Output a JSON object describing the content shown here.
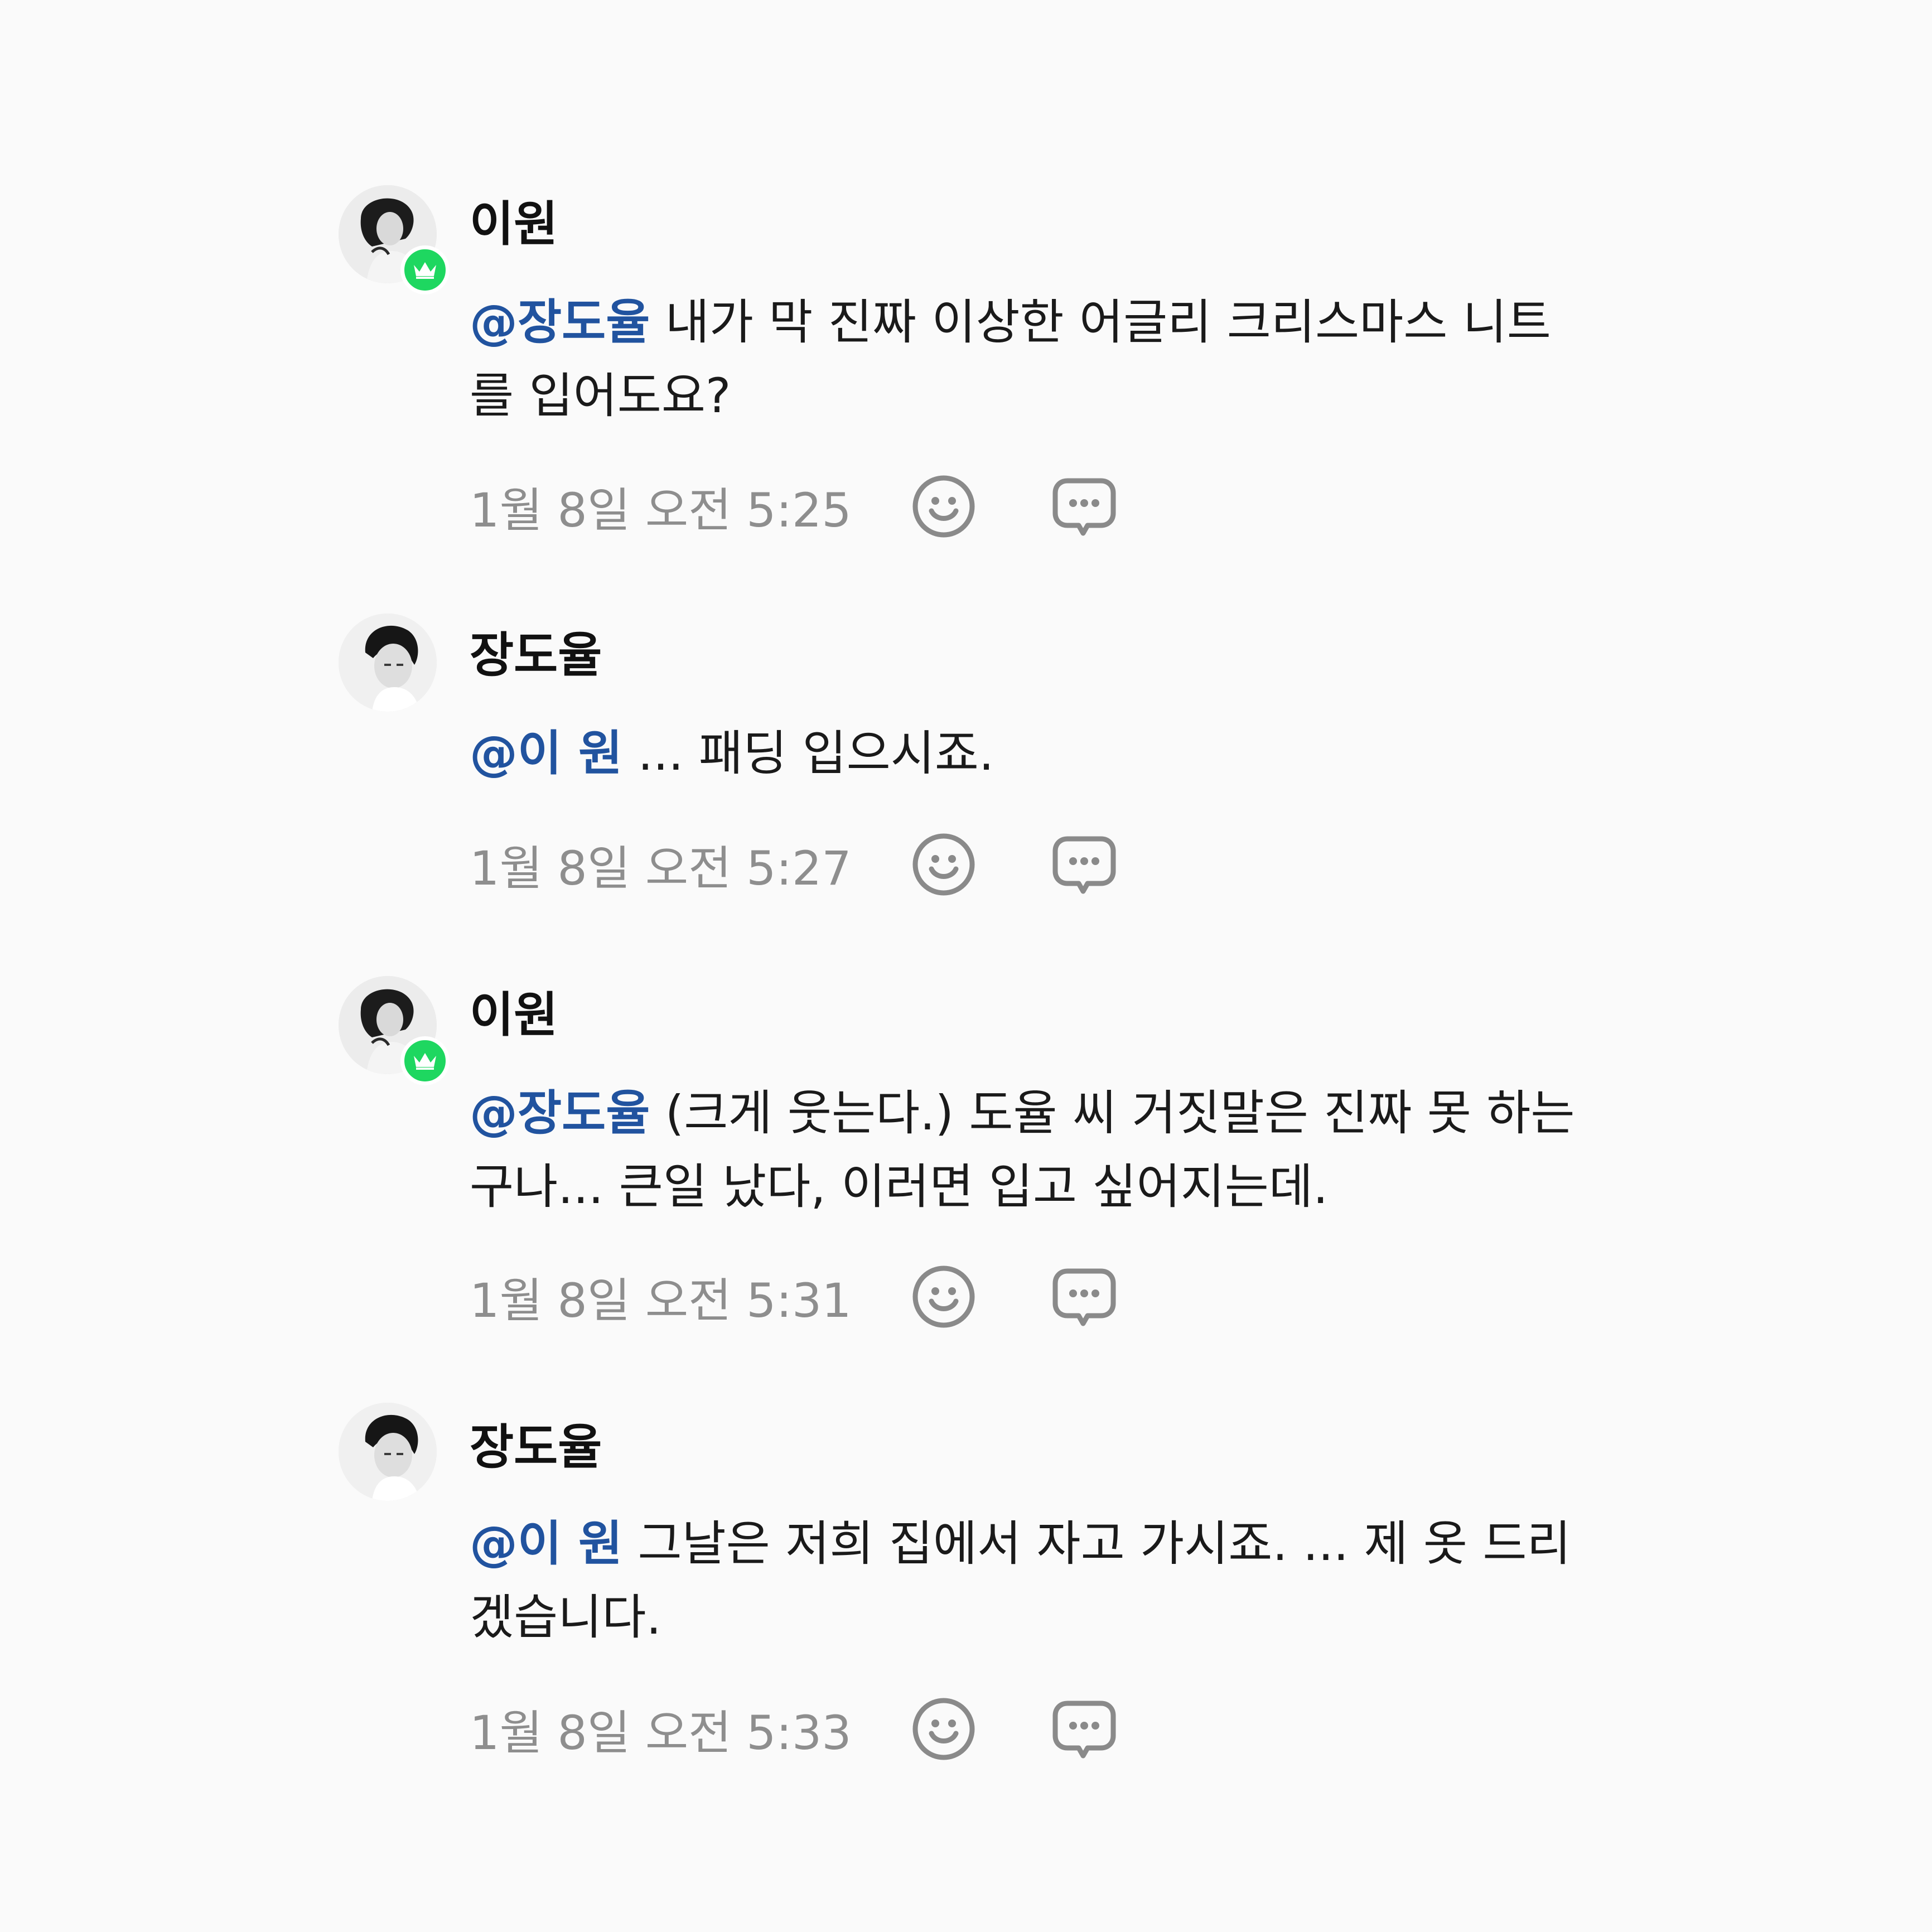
{
  "comments": [
    {
      "author": "이원",
      "mention": "@장도율",
      "text": " 내가 막 진짜 이상한 어글리 크리스마스 니트를 입어도요?",
      "time": "1월 8일 오전 5:25",
      "badge": "crown-icon",
      "avatar": "woman-portrait"
    },
    {
      "author": "장도율",
      "mention": "@이 원",
      "text": " ... 패딩 입으시죠.",
      "time": "1월 8일 오전 5:27",
      "avatar": "man-portrait"
    },
    {
      "author": "이원",
      "mention": "@장도율",
      "text": " (크게 웃는다.) 도율 씨 거짓말은 진짜 못 하는구나... 큰일 났다, 이러면 입고 싶어지는데.",
      "time": "1월 8일 오전 5:31",
      "badge": "crown-icon",
      "avatar": "woman-portrait"
    },
    {
      "author": "장도율",
      "mention": "@이 원",
      "text": " 그날은 저희 집에서 자고 가시죠. ... 제 옷 드리겠습니다.",
      "time": "1월 8일 오전 5:33",
      "avatar": "man-portrait"
    }
  ],
  "icons": {
    "reaction": "smiley-icon",
    "reply": "comment-bubble-icon"
  },
  "colors": {
    "background": "#fafafa",
    "mention": "#21539f",
    "badge": "#1ed760",
    "meta_text": "#8e8e8e",
    "icon_stroke": "#8a8a8a"
  }
}
